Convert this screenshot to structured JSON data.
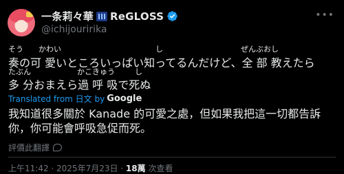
{
  "author": {
    "display_name": "一条莉々華",
    "org": "ReGLOSS",
    "handle": "@ichijouririka"
  },
  "post": {
    "line1_ruby": [
      "そう",
      "かわい",
      "し",
      "ぜんぶおし"
    ],
    "line1_text": "奏の可 愛いところいっぱい知ってるんだけど、全 部 教えたら",
    "line2_ruby": [
      "たぶん",
      "かこきゅう",
      "し"
    ],
    "line2_text": "多 分おまえら過 呼 吸で死ぬ",
    "translated_label": "Translated from 日文 by",
    "translator": "Google",
    "translation": "我知道很多關於 Kanade 的可愛之處，但如果我把這一切都告訴你，你可能會呼吸急促而死。",
    "rate_label": "評價此翻譯",
    "timestamp": "上午11:42 · 2025年7月23日 · ",
    "views": "18萬",
    "views_label": " 次查看"
  },
  "colors": {
    "background": "#000000",
    "text": "#e7e9ea",
    "muted": "#71767b",
    "link": "#1d9bf0"
  }
}
